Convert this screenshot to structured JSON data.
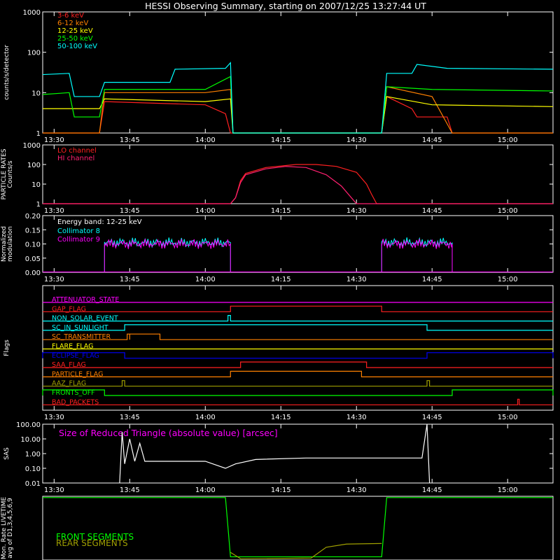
{
  "title": "HESSI Observing Summary, starting on 2007/12/25 13:27:44 UT",
  "colors": {
    "red": "#ff2020",
    "orange": "#ff8000",
    "yellow": "#ffff00",
    "green": "#00ff00",
    "cyan": "#00ffff",
    "magenta": "#ff00ff",
    "white": "#ffffff",
    "blue": "#0000ff",
    "olive": "#a0a000",
    "lo": "#ff2020",
    "hi": "#ff2070"
  },
  "chart_data": [
    {
      "type": "line",
      "panel": "counts",
      "ylabel": "counts/s/detector",
      "ylog": true,
      "ylim": [
        1,
        1000
      ],
      "yticks": [
        "1",
        "10",
        "100",
        "1000"
      ],
      "xlim": [
        "13:27:44",
        "15:09"
      ],
      "xticks": [
        "13:30",
        "13:45",
        "14:00",
        "14:15",
        "14:30",
        "14:45",
        "15:00"
      ],
      "series": [
        {
          "name": "3-6 keV",
          "color": "red",
          "points": [
            [
              "13:27:44",
              0.5
            ],
            [
              "13:39",
              0.5
            ],
            [
              "13:40",
              6
            ],
            [
              "14:00",
              5
            ],
            [
              "14:04",
              3
            ],
            [
              "14:05",
              0.5
            ],
            [
              "14:35",
              0.5
            ],
            [
              "14:36",
              8
            ],
            [
              "14:41",
              4
            ],
            [
              "14:42",
              2.5
            ],
            [
              "14:48",
              2.5
            ],
            [
              "14:49",
              0.5
            ],
            [
              "15:09",
              0.5
            ]
          ]
        },
        {
          "name": "6-12 keV",
          "color": "orange",
          "points": [
            [
              "13:27:44",
              0.5
            ],
            [
              "13:39",
              0.5
            ],
            [
              "13:40",
              10
            ],
            [
              "14:00",
              10
            ],
            [
              "14:05",
              12
            ],
            [
              "14:05.5",
              0.5
            ],
            [
              "14:35",
              0.5
            ],
            [
              "14:36",
              14
            ],
            [
              "14:45",
              8
            ],
            [
              "14:49",
              0.5
            ],
            [
              "15:09",
              0.5
            ]
          ]
        },
        {
          "name": "12-25 keV",
          "color": "yellow",
          "points": [
            [
              "13:27:44",
              4
            ],
            [
              "13:33",
              4
            ],
            [
              "13:34",
              4
            ],
            [
              "13:39",
              4
            ],
            [
              "13:40",
              7
            ],
            [
              "14:00",
              6
            ],
            [
              "14:05",
              7
            ],
            [
              "14:05.5",
              0.5
            ],
            [
              "14:35",
              0.5
            ],
            [
              "14:36",
              8
            ],
            [
              "14:45",
              5
            ],
            [
              "15:09",
              4.5
            ]
          ]
        },
        {
          "name": "25-50 keV",
          "color": "green",
          "points": [
            [
              "13:27:44",
              9
            ],
            [
              "13:33",
              10
            ],
            [
              "13:34",
              2.5
            ],
            [
              "13:39",
              2.5
            ],
            [
              "13:40",
              12
            ],
            [
              "14:00",
              12
            ],
            [
              "14:05",
              25
            ],
            [
              "14:05.5",
              0.5
            ],
            [
              "14:35",
              0.5
            ],
            [
              "14:36",
              14
            ],
            [
              "14:45",
              12
            ],
            [
              "15:09",
              11
            ]
          ]
        },
        {
          "name": "50-100 keV",
          "color": "cyan",
          "points": [
            [
              "13:27:44",
              28
            ],
            [
              "13:33",
              30
            ],
            [
              "13:34",
              8
            ],
            [
              "13:39",
              8
            ],
            [
              "13:40",
              18
            ],
            [
              "13:53",
              18
            ],
            [
              "13:54",
              38
            ],
            [
              "14:04",
              40
            ],
            [
              "14:05",
              55
            ],
            [
              "14:05.5",
              0.8
            ],
            [
              "14:35",
              0.8
            ],
            [
              "14:36",
              30
            ],
            [
              "14:41",
              30
            ],
            [
              "14:42",
              50
            ],
            [
              "14:48",
              40
            ],
            [
              "15:09",
              38
            ]
          ]
        }
      ]
    },
    {
      "type": "line",
      "panel": "particle",
      "ylabel": "PARTICLE RATES Counts/s",
      "ylog": true,
      "ylim": [
        1,
        1000
      ],
      "yticks": [
        "1",
        "10",
        "100",
        "1000"
      ],
      "xlim": [
        "13:27:44",
        "15:09"
      ],
      "xticks": [
        "13:30",
        "13:45",
        "14:00",
        "14:15",
        "14:30",
        "14:45",
        "15:00"
      ],
      "series": [
        {
          "name": "LO channel",
          "color": "lo",
          "points": [
            [
              "13:27:44",
              0.9
            ],
            [
              "14:05",
              0.9
            ],
            [
              "14:06",
              2
            ],
            [
              "14:07",
              15
            ],
            [
              "14:08",
              35
            ],
            [
              "14:12",
              70
            ],
            [
              "14:18",
              100
            ],
            [
              "14:22",
              100
            ],
            [
              "14:26",
              80
            ],
            [
              "14:30",
              40
            ],
            [
              "14:32",
              10
            ],
            [
              "14:33",
              3
            ],
            [
              "14:34",
              1
            ],
            [
              "15:09",
              0.9
            ]
          ]
        },
        {
          "name": "HI channel",
          "color": "hi",
          "points": [
            [
              "13:27:44",
              0.9
            ],
            [
              "14:05",
              0.9
            ],
            [
              "14:06",
              2
            ],
            [
              "14:07",
              12
            ],
            [
              "14:08",
              30
            ],
            [
              "14:12",
              60
            ],
            [
              "14:16",
              80
            ],
            [
              "14:20",
              70
            ],
            [
              "14:24",
              30
            ],
            [
              "14:27",
              8
            ],
            [
              "14:29",
              2
            ],
            [
              "14:30",
              1
            ],
            [
              "15:09",
              0.9
            ]
          ]
        }
      ]
    },
    {
      "type": "line",
      "panel": "modulation",
      "ylabel": "Normalized modulation",
      "annotation": "Energy band: 12-25 keV",
      "ylim": [
        0,
        0.2
      ],
      "yticks": [
        "0.00",
        "0.05",
        "0.10",
        "0.15",
        "0.20"
      ],
      "xlim": [
        "13:27:44",
        "15:09"
      ],
      "xticks": [
        "13:30",
        "13:45",
        "14:00",
        "14:15",
        "14:30",
        "14:45",
        "15:00"
      ],
      "series": [
        {
          "name": "Collimator 8",
          "color": "cyan",
          "segments": [
            [
              "13:40",
              "14:05",
              0.105
            ],
            [
              "14:35",
              "14:49",
              0.105
            ]
          ]
        },
        {
          "name": "Collimator 9",
          "color": "magenta",
          "segments": [
            [
              "13:40",
              "14:05",
              0.1
            ],
            [
              "14:35",
              "14:49",
              0.1
            ]
          ]
        }
      ]
    },
    {
      "type": "line",
      "panel": "flags",
      "ylabel": "Flags",
      "xlim": [
        "13:27:44",
        "15:09"
      ],
      "xticks": [
        "13:30",
        "13:45",
        "14:00",
        "14:15",
        "14:30",
        "14:45",
        "15:00"
      ],
      "series": [
        {
          "name": "ATTENUATOR_STATE",
          "color": "magenta",
          "high_intervals": []
        },
        {
          "name": "GAP_FLAG",
          "color": "red",
          "high_intervals": [
            [
              "14:05",
              "14:35"
            ]
          ]
        },
        {
          "name": "NON_SOLAR_EVENT",
          "color": "cyan",
          "high_intervals": [
            [
              "14:04.5",
              "14:05"
            ]
          ]
        },
        {
          "name": "SC_IN_SUNLIGHT",
          "color": "cyan",
          "high_intervals": [
            [
              "13:44",
              "14:44"
            ]
          ]
        },
        {
          "name": "SC_TRANSMITTER",
          "color": "orange",
          "high_intervals": [
            [
              "13:44.5",
              "13:45"
            ],
            [
              "13:45",
              "13:51"
            ]
          ]
        },
        {
          "name": "FLARE_FLAG",
          "color": "yellow",
          "high_intervals": []
        },
        {
          "name": "ECLIPSE_FLAG",
          "color": "blue",
          "high_intervals": [
            [
              "13:27:44",
              "13:44"
            ],
            [
              "14:44",
              "15:09"
            ]
          ]
        },
        {
          "name": "SAA_FLAG",
          "color": "red",
          "high_intervals": [
            [
              "14:07",
              "14:32"
            ]
          ]
        },
        {
          "name": "PARTICLE_FLAG",
          "color": "orange",
          "high_intervals": [
            [
              "14:05",
              "14:31"
            ]
          ]
        },
        {
          "name": "AAZ_FLAG",
          "color": "olive",
          "high_intervals": [
            [
              "13:43.5",
              "13:44"
            ],
            [
              "14:44",
              "14:44.5"
            ]
          ]
        },
        {
          "name": "FRONTS_OFF",
          "color": "green",
          "high_intervals": [
            [
              "13:27:44",
              "13:40"
            ],
            [
              "14:49",
              "15:09"
            ]
          ]
        },
        {
          "name": "BAD_PACKETS",
          "color": "red",
          "high_intervals": [
            [
              "15:02",
              "15:02.3"
            ]
          ]
        }
      ]
    },
    {
      "type": "line",
      "panel": "sas",
      "ylabel": "SAS",
      "annotation": "Size of Reduced Triangle (absolute value) [arcsec]",
      "ylog": true,
      "ylim": [
        0.01,
        100
      ],
      "yticks": [
        "0.01",
        "0.10",
        "1.00",
        "10.00",
        "100.00"
      ],
      "xlim": [
        "13:27:44",
        "15:09"
      ],
      "xticks": [
        "13:30",
        "13:45",
        "14:00",
        "14:15",
        "14:30",
        "14:45",
        "15:00"
      ],
      "series": [
        {
          "name": "",
          "color": "white",
          "points": [
            [
              "13:43",
              0.01
            ],
            [
              "13:43.5",
              30
            ],
            [
              "13:44",
              0.2
            ],
            [
              "13:45",
              10
            ],
            [
              "13:46",
              0.3
            ],
            [
              "13:47",
              5
            ],
            [
              "13:48",
              0.3
            ],
            [
              "14:00",
              0.3
            ],
            [
              "14:04",
              0.1
            ],
            [
              "14:06",
              0.2
            ],
            [
              "14:10",
              0.4
            ],
            [
              "14:20",
              0.5
            ],
            [
              "14:30",
              0.5
            ],
            [
              "14:40",
              0.5
            ],
            [
              "14:43",
              0.5
            ],
            [
              "14:44",
              100
            ],
            [
              "14:44.5",
              0.01
            ]
          ]
        }
      ]
    },
    {
      "type": "line",
      "panel": "livetime",
      "ylabel": "Mon. Rate LIVETIME avg of D1,3,4,5,6,9",
      "ylim": [
        0,
        1
      ],
      "xlim": [
        "13:27:44",
        "15:09"
      ],
      "series": [
        {
          "name": "FRONT SEGMENTS",
          "color": "green",
          "points": [
            [
              "13:27:44",
              0.98
            ],
            [
              "14:04",
              0.98
            ],
            [
              "14:05",
              0.05
            ],
            [
              "14:35",
              0.05
            ],
            [
              "14:36",
              0.98
            ],
            [
              "15:09",
              0.98
            ]
          ]
        },
        {
          "name": "REAR SEGMENTS",
          "color": "olive",
          "points": [
            [
              "14:05",
              0.12
            ],
            [
              "14:07",
              0.02
            ],
            [
              "14:21",
              0.03
            ],
            [
              "14:24",
              0.2
            ],
            [
              "14:28",
              0.25
            ],
            [
              "14:35",
              0.26
            ]
          ]
        }
      ]
    }
  ]
}
